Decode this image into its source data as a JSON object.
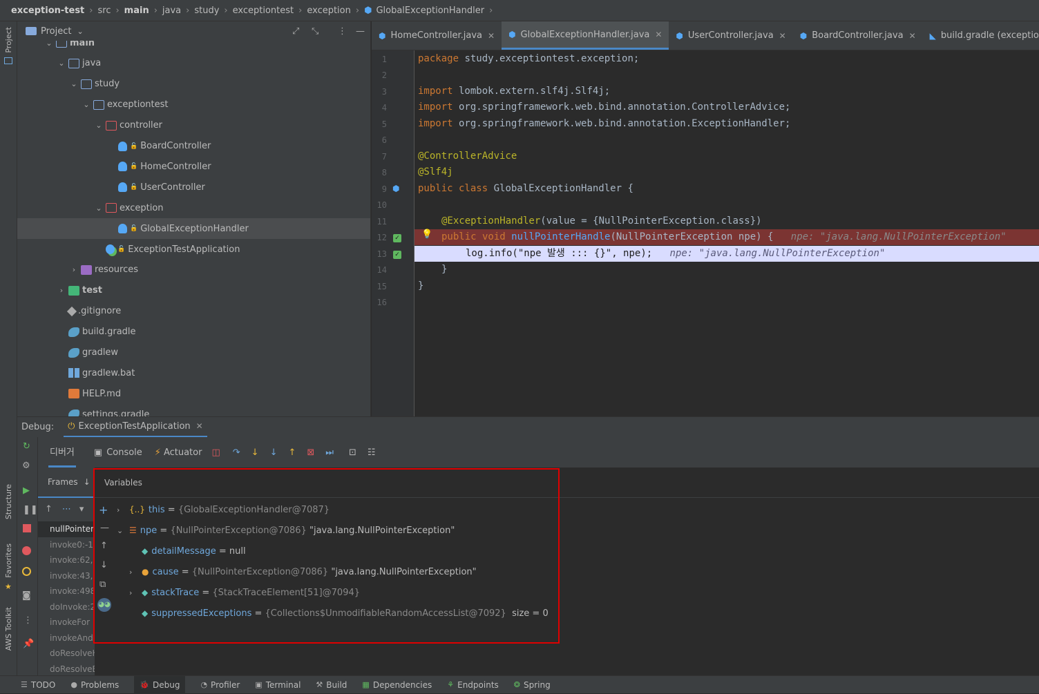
{
  "breadcrumb": [
    "exception-test",
    "src",
    "main",
    "java",
    "study",
    "exceptiontest",
    "exception",
    "GlobalExceptionHandler"
  ],
  "left_strip": {
    "project": "Project",
    "structure": "Structure",
    "favorites": "Favorites",
    "aws": "AWS Toolkit"
  },
  "project_panel": {
    "title": "Project",
    "tree": [
      {
        "label": "main",
        "depth": 0,
        "chev": "v",
        "icon": "folder"
      },
      {
        "label": "java",
        "depth": 1,
        "chev": "v",
        "icon": "folder"
      },
      {
        "label": "study",
        "depth": 2,
        "chev": "v",
        "icon": "folder"
      },
      {
        "label": "exceptiontest",
        "depth": 3,
        "chev": "v",
        "icon": "folder"
      },
      {
        "label": "controller",
        "depth": 4,
        "chev": "v",
        "icon": "folder-red"
      },
      {
        "label": "BoardController",
        "depth": 5,
        "chev": "",
        "icon": "class"
      },
      {
        "label": "HomeController",
        "depth": 5,
        "chev": "",
        "icon": "class"
      },
      {
        "label": "UserController",
        "depth": 5,
        "chev": "",
        "icon": "class"
      },
      {
        "label": "exception",
        "depth": 4,
        "chev": "v",
        "icon": "folder-red"
      },
      {
        "label": "GlobalExceptionHandler",
        "depth": 5,
        "chev": "",
        "icon": "class",
        "selected": true
      },
      {
        "label": "ExceptionTestApplication",
        "depth": 4,
        "chev": "",
        "icon": "class-run"
      },
      {
        "label": "resources",
        "depth": 2,
        "chev": ">",
        "icon": "folder-purple"
      },
      {
        "label": "test",
        "depth": 1,
        "chev": ">",
        "icon": "folder-green"
      },
      {
        "label": ".gitignore",
        "depth": 1,
        "chev": "",
        "icon": "git"
      },
      {
        "label": "build.gradle",
        "depth": 1,
        "chev": "",
        "icon": "gradle"
      },
      {
        "label": "gradlew",
        "depth": 1,
        "chev": "",
        "icon": "gradle"
      },
      {
        "label": "gradlew.bat",
        "depth": 1,
        "chev": "",
        "icon": "windows"
      },
      {
        "label": "HELP.md",
        "depth": 1,
        "chev": "",
        "icon": "md"
      },
      {
        "label": "settings.gradle",
        "depth": 1,
        "chev": "",
        "icon": "gradle"
      }
    ]
  },
  "tabs": [
    {
      "label": "HomeController.java",
      "active": false
    },
    {
      "label": "GlobalExceptionHandler.java",
      "active": true
    },
    {
      "label": "UserController.java",
      "active": false
    },
    {
      "label": "BoardController.java",
      "active": false
    },
    {
      "label": "build.gradle (exception-test)",
      "active": false
    }
  ],
  "code": {
    "lines": [
      "1",
      "2",
      "3",
      "4",
      "5",
      "6",
      "7",
      "8",
      "9",
      "10",
      "11",
      "12",
      "13",
      "14",
      "15",
      "16"
    ],
    "l1_kw": "package",
    "l1_rest": " study.exceptiontest.exception;",
    "l3_kw": "import",
    "l3_rest": " lombok.extern.slf4j.Slf4j;",
    "l4_kw": "import",
    "l4_rest": " org.springframework.web.bind.annotation.ControllerAdvice;",
    "l5_kw": "import",
    "l5_rest": " org.springframework.web.bind.annotation.ExceptionHandler;",
    "l7": "@ControllerAdvice",
    "l8": "@Slf4j",
    "l9_kw": "public class",
    "l9_rest": " GlobalExceptionHandler {",
    "l11_an": "@ExceptionHandler",
    "l11_rest": "(value = {NullPointerException.class})",
    "l12_kw": "public void",
    "l12_fn": "nullPointerHandle",
    "l12_rest": "(NullPointerException npe) {",
    "l12_hint": "npe: \"java.lang.NullPointerException\"",
    "l13_a": "log.info(",
    "l13_str": "\"npe 발생 ::: {}\"",
    "l13_b": ", npe);",
    "l13_hint": "npe: \"java.lang.NullPointerException\"",
    "l14": "}",
    "l15": "}"
  },
  "debug": {
    "label": "Debug:",
    "session": "ExceptionTestApplication",
    "tab_debugger": "디버거",
    "tab_console": "Console",
    "tab_actuator": "Actuator",
    "frames_label": "Frames",
    "variables_label": "Variables",
    "frames": [
      "nullPointer",
      "invoke0:-1",
      "invoke:62,",
      "invoke:43,",
      "invoke:498",
      "doInvoke:2",
      "invokeFor",
      "invokeAnd",
      "doResolveH",
      "doResolveE"
    ],
    "variables": [
      {
        "name": "this",
        "eq": " = ",
        "type": "{GlobalExceptionHandler@7087}",
        "value": "",
        "icon": "obj",
        "chev": ">",
        "indent": 0
      },
      {
        "name": "npe",
        "eq": " = ",
        "type": "{NullPointerException@7086}",
        "value": " \"java.lang.NullPointerException\"",
        "icon": "list",
        "chev": "v",
        "indent": 0
      },
      {
        "name": "detailMessage",
        "eq": " = ",
        "type": "",
        "value": "null",
        "icon": "tag",
        "chev": "",
        "indent": 1
      },
      {
        "name": "cause",
        "eq": " = ",
        "type": "{NullPointerException@7086}",
        "value": " \"java.lang.NullPointerException\"",
        "icon": "ex",
        "chev": ">",
        "indent": 1
      },
      {
        "name": "stackTrace",
        "eq": " = ",
        "type": "{StackTraceElement[51]@7094}",
        "value": "",
        "icon": "tag",
        "chev": ">",
        "indent": 1
      },
      {
        "name": "suppressedExceptions",
        "eq": " = ",
        "type": "{Collections$UnmodifiableRandomAccessList@7092}",
        "value": "  size = 0",
        "icon": "tag",
        "chev": "",
        "indent": 1
      }
    ]
  },
  "status_bar": [
    "TODO",
    "Problems",
    "Debug",
    "Profiler",
    "Terminal",
    "Build",
    "Dependencies",
    "Endpoints",
    "Spring"
  ],
  "colors": {
    "accent": "#4a88c7",
    "breakpoint_line": "#7b3432",
    "exec_line": "#d9dcff",
    "highlight_box": "#e00000"
  }
}
